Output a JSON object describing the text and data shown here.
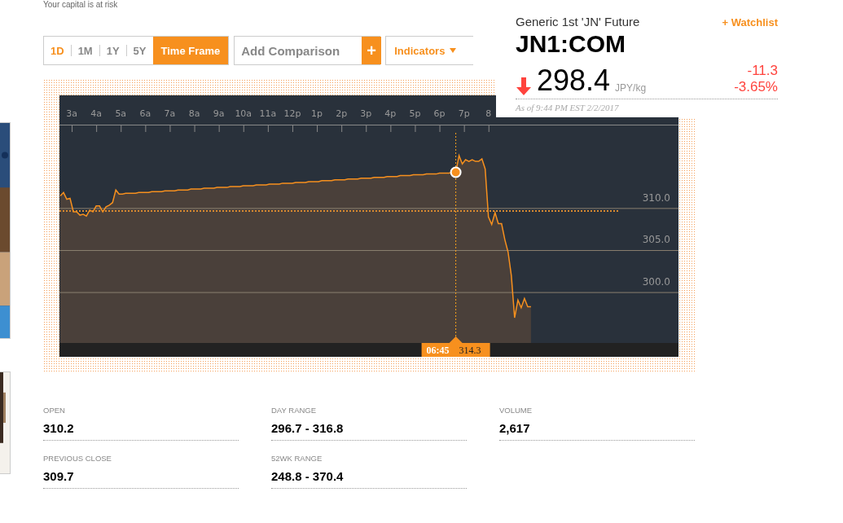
{
  "disclaimer": "Your capital is at risk",
  "toolbar": {
    "periods": [
      {
        "label": "1D",
        "selected": true
      },
      {
        "label": "1M",
        "selected": false
      },
      {
        "label": "1Y",
        "selected": false
      },
      {
        "label": "5Y",
        "selected": false
      }
    ],
    "time_frame": "Time Frame",
    "comparison": {
      "placeholder": "Add Comparison",
      "button": "+"
    },
    "indicators": "Indicators"
  },
  "quote": {
    "name": "Generic 1st 'JN' Future",
    "watchlist": "+ Watchlist",
    "ticker": "JN1:COM",
    "price": "298.4",
    "unit": "JPY/kg",
    "change": "-11.3",
    "change_pct": "-3.65%",
    "as_of": "As of 9:44 PM EST 2/2/2017"
  },
  "chart": {
    "time_labels": [
      "3a",
      "4a",
      "5a",
      "6a",
      "7a",
      "8a",
      "9a",
      "10a",
      "11a",
      "12p",
      "1p",
      "2p",
      "3p",
      "4p",
      "5p",
      "6p",
      "7p",
      "8"
    ],
    "tooltip": {
      "time": "06:45",
      "value": "314.3"
    },
    "chart_data": {
      "type": "area",
      "grid": true,
      "categories": [
        null,
        null,
        null,
        null,
        null,
        null,
        null,
        null,
        null,
        null,
        null,
        null,
        null,
        null,
        null,
        null,
        null,
        null,
        null,
        null,
        null,
        null,
        null,
        null,
        null,
        null,
        null,
        null,
        null,
        null,
        null,
        null,
        null,
        null,
        null,
        null,
        null,
        null,
        null,
        null,
        null,
        null,
        null,
        null,
        null,
        null,
        null,
        null,
        null,
        null,
        null,
        null,
        null,
        null,
        null,
        null,
        null,
        null,
        null,
        null,
        null,
        null,
        null,
        null,
        null,
        null,
        null,
        null,
        null,
        null,
        null,
        null,
        null,
        null,
        null,
        null,
        null,
        null,
        null,
        null,
        null,
        null,
        null,
        null,
        null,
        null,
        null,
        null,
        null,
        null,
        null,
        null,
        null,
        null,
        null,
        null,
        null,
        null,
        null,
        null,
        null,
        null,
        null,
        null,
        null,
        null,
        null,
        null,
        null,
        null,
        null,
        null,
        null,
        null,
        null,
        null,
        null,
        null,
        null,
        null,
        null,
        null,
        null,
        null,
        null,
        null,
        null,
        null,
        null,
        null,
        null,
        null,
        null,
        null,
        null,
        null,
        null,
        null,
        null,
        null,
        null,
        null,
        null,
        null,
        null
      ],
      "series": [
        {
          "color": "#f7901e",
          "values": [
            311.5,
            311.9,
            311.1,
            311.2,
            309.6,
            309.6,
            309.2,
            309.3,
            309.1,
            309.8,
            309.6,
            310.3,
            310.3,
            309.6,
            310.2,
            310.4,
            310.7,
            312.2,
            311.7,
            311.7,
            311.8,
            311.8,
            311.8,
            311.8,
            311.9,
            311.9,
            311.9,
            311.9,
            312.0,
            312.0,
            312.0,
            312.0,
            312.1,
            312.1,
            312.1,
            312.1,
            312.2,
            312.2,
            312.2,
            312.2,
            312.3,
            312.3,
            312.3,
            312.3,
            312.4,
            312.4,
            312.4,
            312.4,
            312.5,
            312.5,
            312.5,
            312.5,
            312.6,
            312.6,
            312.6,
            312.6,
            312.7,
            312.7,
            312.7,
            312.7,
            312.8,
            312.8,
            312.8,
            312.8,
            312.9,
            312.9,
            312.9,
            312.9,
            313.0,
            313.0,
            313.0,
            313.0,
            313.1,
            313.1,
            313.1,
            313.1,
            313.2,
            313.2,
            313.2,
            313.2,
            313.3,
            313.3,
            313.3,
            313.3,
            313.4,
            313.4,
            313.4,
            313.4,
            313.5,
            313.5,
            313.5,
            313.5,
            313.6,
            313.6,
            313.6,
            313.6,
            313.7,
            313.7,
            313.7,
            313.7,
            313.8,
            313.8,
            313.8,
            313.8,
            313.9,
            313.9,
            313.9,
            313.9,
            314.0,
            314.0,
            314.0,
            314.0,
            314.1,
            314.1,
            314.1,
            314.1,
            314.2,
            314.2,
            314.2,
            314.2,
            314.3,
            314.3,
            316.3,
            315.3,
            315.8,
            315.6,
            315.8,
            315.6,
            315.6,
            315.9,
            314.7,
            309.0,
            308.1,
            309.5,
            308.2,
            308.2,
            306.3,
            304.8,
            302.0,
            297.0,
            299.1,
            298.2,
            299.3,
            298.3,
            298.3
          ]
        }
      ],
      "ylim": [
        294,
        319
      ],
      "yticks": [
        {
          "value": 300,
          "label": "300.0"
        },
        {
          "value": 305,
          "label": "305.0"
        },
        {
          "value": 310,
          "label": "310.0"
        }
      ],
      "ref_lines": [
        {
          "axis": "y",
          "value": 309.7
        }
      ]
    }
  },
  "stats": [
    {
      "label": "OPEN",
      "value": "310.2"
    },
    {
      "label": "DAY RANGE",
      "value": "296.7 - 316.8"
    },
    {
      "label": "VOLUME",
      "value": "2,617"
    },
    {
      "label": "PREVIOUS CLOSE",
      "value": "309.7"
    },
    {
      "label": "52WK RANGE",
      "value": "248.8 - 370.4"
    }
  ]
}
